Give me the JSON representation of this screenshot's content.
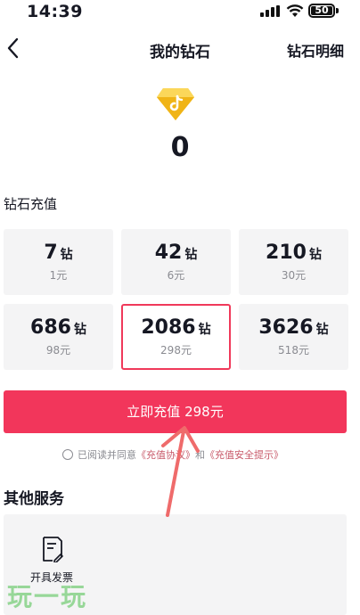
{
  "status_bar": {
    "time": "14:39",
    "battery": "50"
  },
  "nav": {
    "title": "我的钻石",
    "right_link": "钻石明细"
  },
  "balance": {
    "value": "0"
  },
  "recharge": {
    "section_title": "钻石充值",
    "options": [
      {
        "amount": "7",
        "unit": "钻",
        "price": "1元",
        "selected": false
      },
      {
        "amount": "42",
        "unit": "钻",
        "price": "6元",
        "selected": false
      },
      {
        "amount": "210",
        "unit": "钻",
        "price": "30元",
        "selected": false
      },
      {
        "amount": "686",
        "unit": "钻",
        "price": "98元",
        "selected": false
      },
      {
        "amount": "2086",
        "unit": "钻",
        "price": "298元",
        "selected": true
      },
      {
        "amount": "3626",
        "unit": "钻",
        "price": "518元",
        "selected": false
      }
    ],
    "button_label": "立即充值 298元"
  },
  "agreement": {
    "prefix": "已阅读并同意",
    "link1": "《充值协议》",
    "connector": "和",
    "link2": "《充值安全提示》"
  },
  "other_services": {
    "title": "其他服务",
    "items": [
      {
        "label": "开具发票",
        "icon": "invoice-icon"
      }
    ]
  },
  "watermark": "玩一玩",
  "colors": {
    "accent": "#f2365b",
    "selected_border": "#f0395a",
    "card_bg": "#f4f4f5",
    "annotation_arrow": "#ef6b6b",
    "link": "#c85a6a"
  }
}
